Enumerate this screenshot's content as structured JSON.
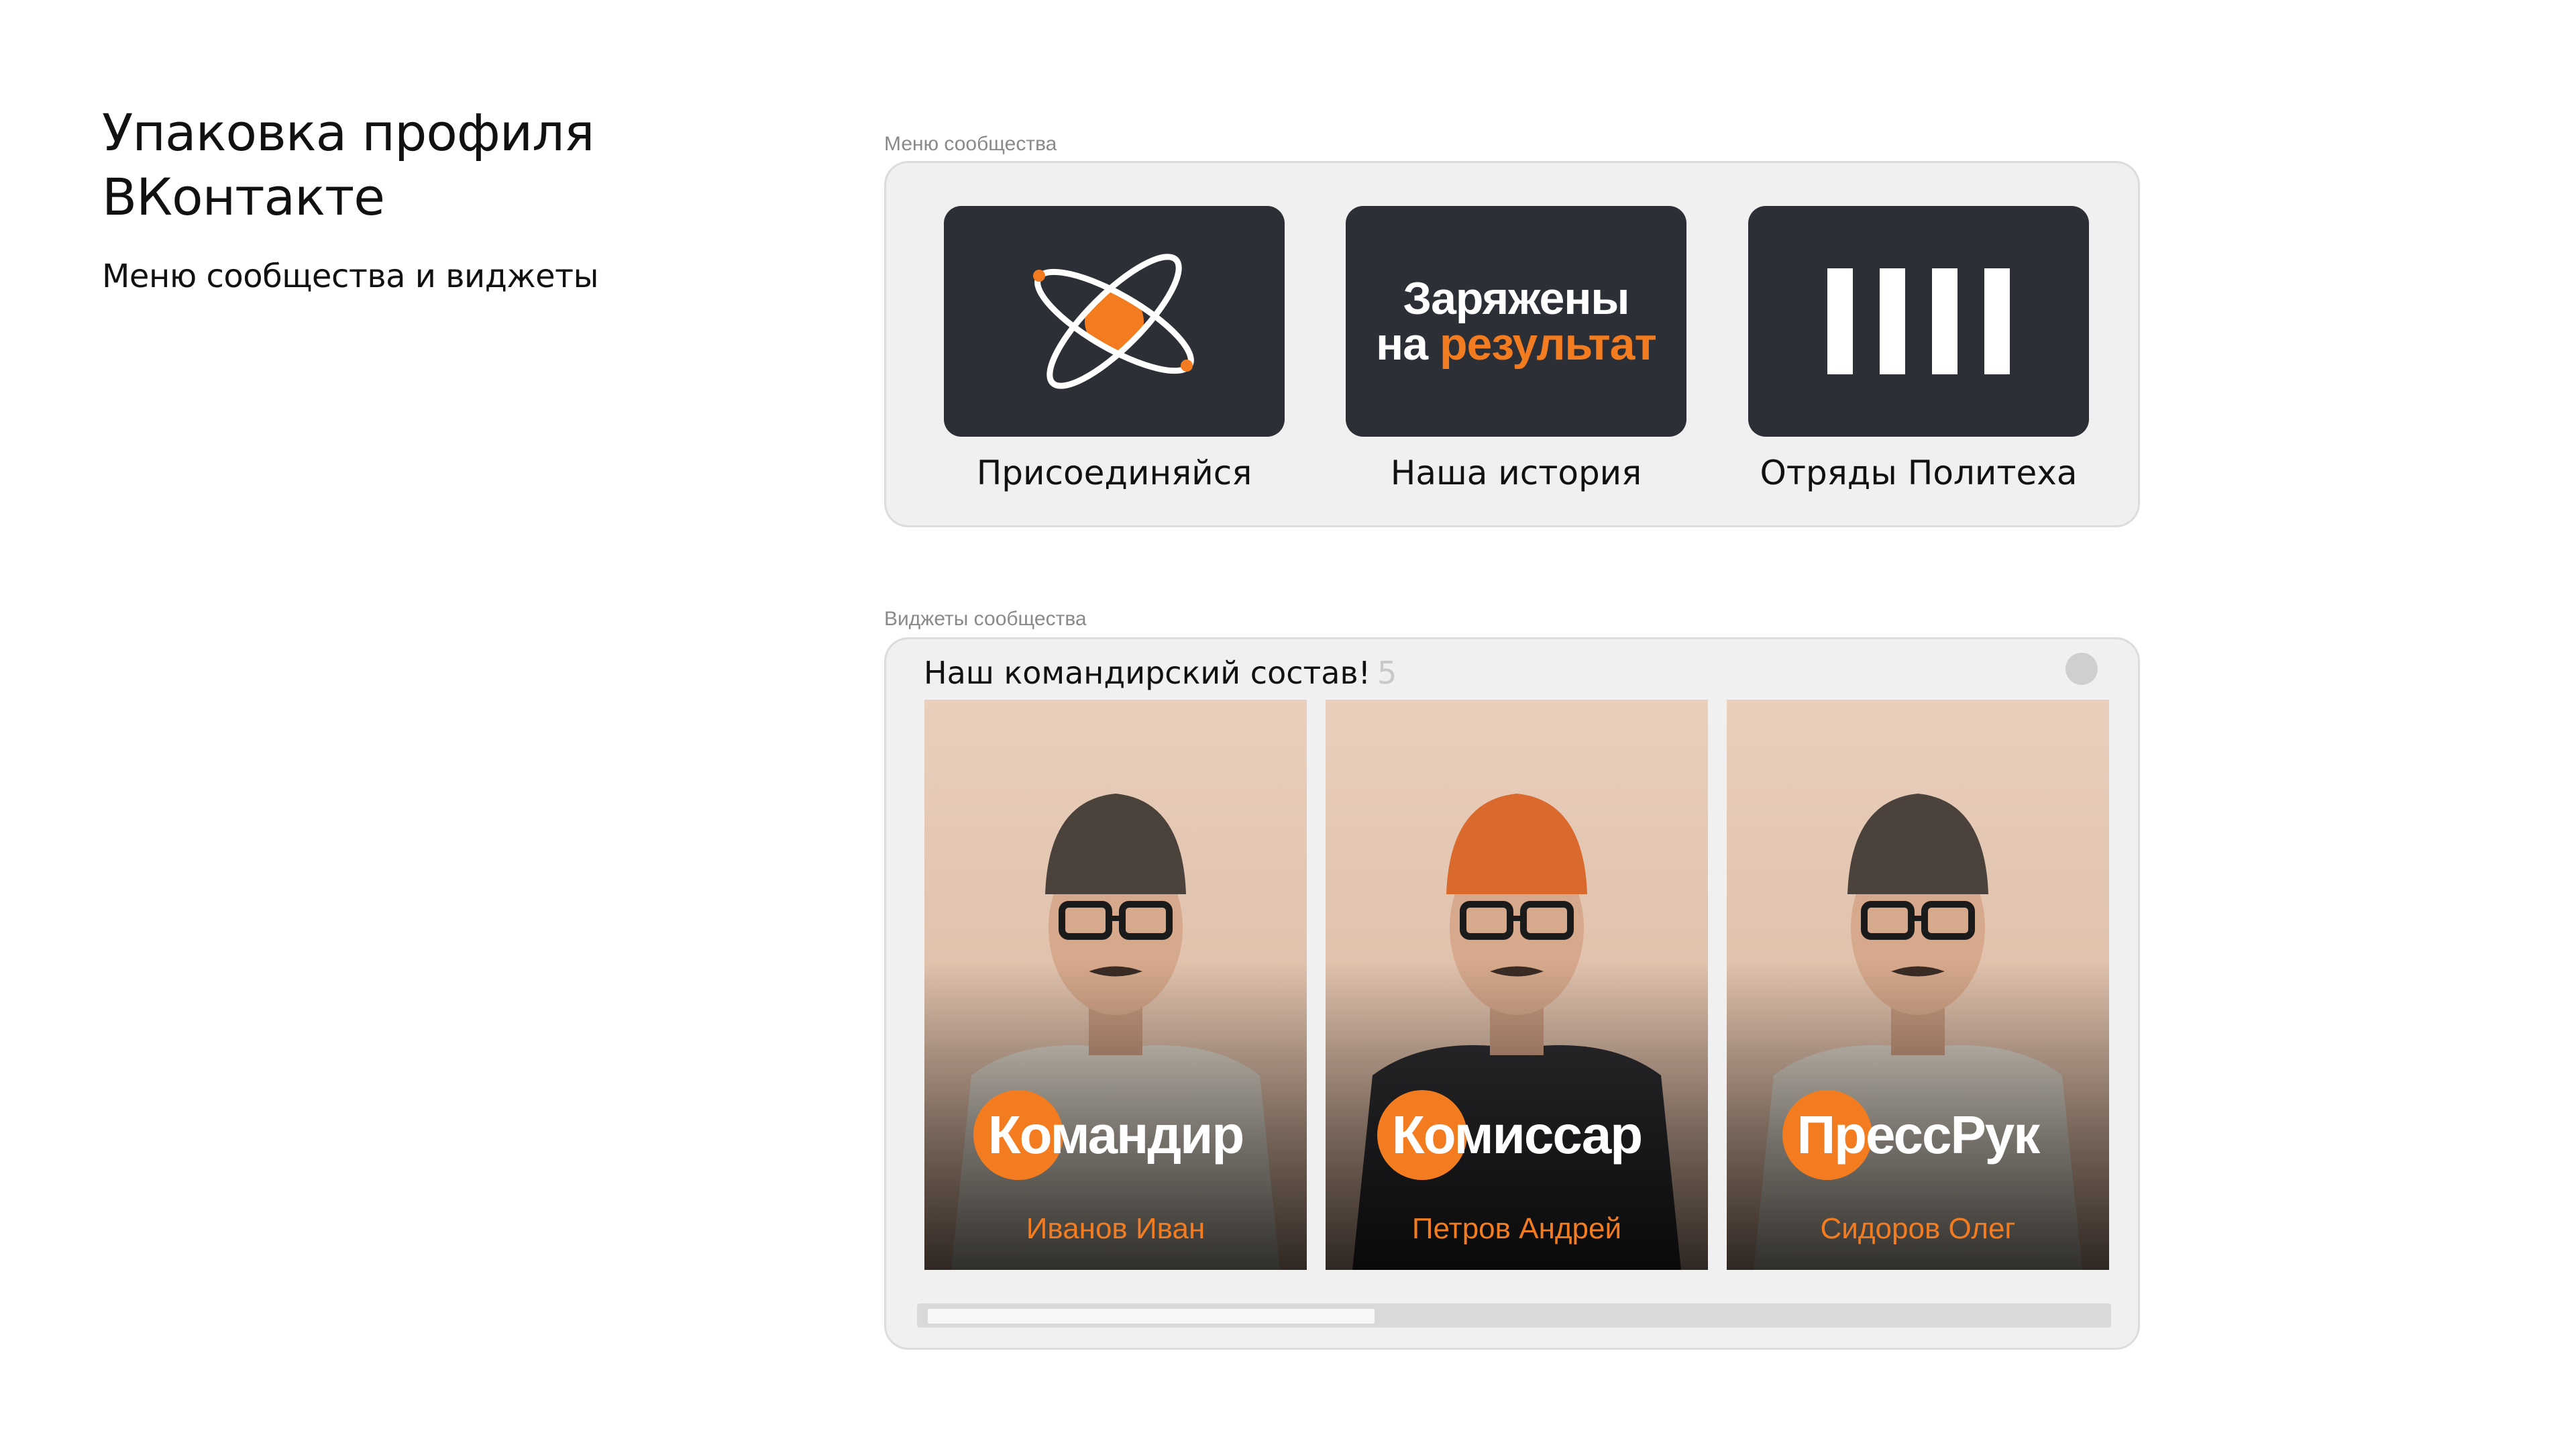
{
  "header": {
    "title": "Упаковка профиля ВКонтакте",
    "subtitle": "Меню сообщества и виджеты"
  },
  "menu_section": {
    "label": "Меню сообщества",
    "items": [
      {
        "label": "Присоединяйся",
        "icon": "atom-icon"
      },
      {
        "label": "Наша история",
        "tile_line1": "Заряжены",
        "tile_line2_prefix": "на ",
        "tile_line2_accent": "результат"
      },
      {
        "label": "Отряды Политеха",
        "icon": "four-bars-icon"
      }
    ]
  },
  "widget_section": {
    "label": "Виджеты сообщества",
    "title": "Наш командирский состав!",
    "count": "5",
    "cards": [
      {
        "role": "Командир",
        "name": "Иванов Иван",
        "hat": "#4a423b",
        "shirt": "#ddd5c8"
      },
      {
        "role": "Комиссар",
        "name": "Петров Андрей",
        "hat": "#d9692c",
        "shirt": "#2e2d31"
      },
      {
        "role": "ПрессРук",
        "name": "Сидоров Олег",
        "hat": "#4a423b",
        "shirt": "#ddd5c8"
      }
    ]
  },
  "colors": {
    "accent": "#f37c20",
    "tile_bg": "#2c2f36",
    "panel_bg": "#f0f0f0"
  }
}
